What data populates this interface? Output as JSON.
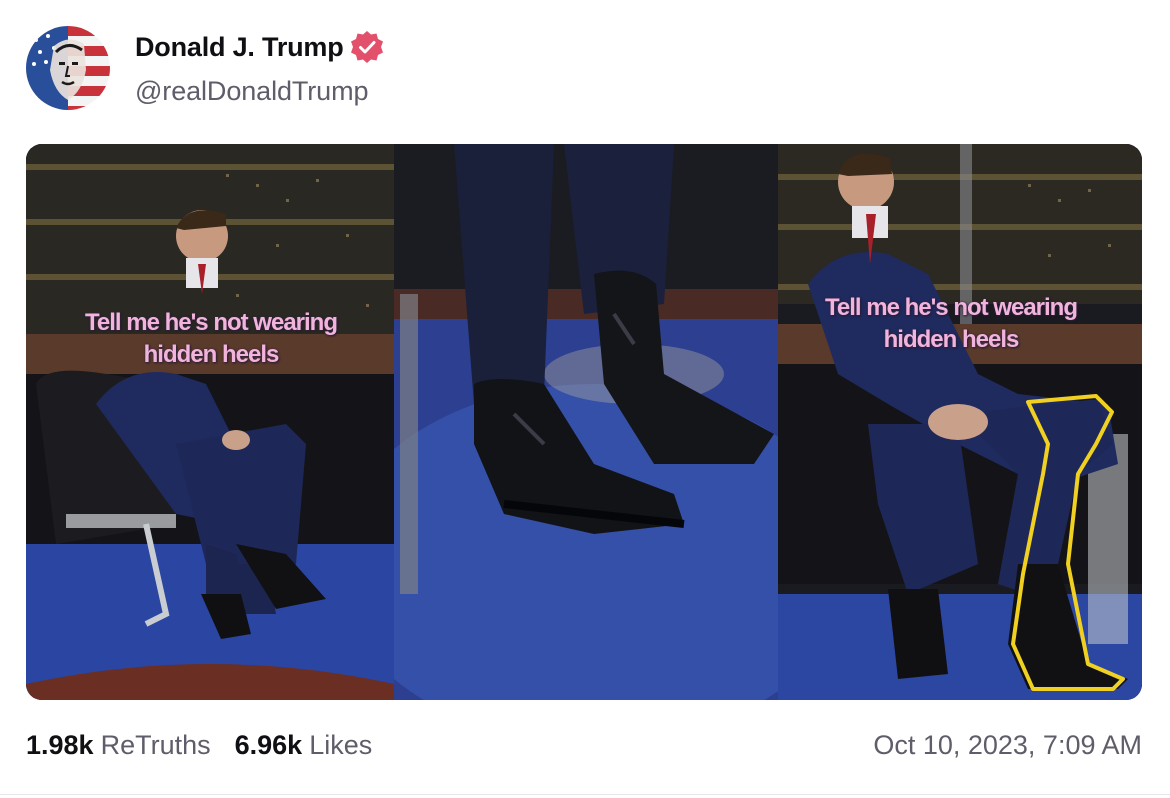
{
  "post": {
    "author_name": "Donald J. Trump",
    "handle": "@realDonaldTrump",
    "verified": true
  },
  "media": {
    "panels": [
      {
        "caption_line1": "Tell me he's not wearing",
        "caption_line2": "hidden heels"
      },
      {
        "caption_line1": "",
        "caption_line2": ""
      },
      {
        "caption_line1": "Tell me he's not wearing",
        "caption_line2": "hidden heels"
      }
    ]
  },
  "stats": {
    "retruths_count": "1.98k",
    "retruths_label": "ReTruths",
    "likes_count": "6.96k",
    "likes_label": "Likes"
  },
  "timestamp": "Oct 10, 2023, 7:09 AM",
  "colors": {
    "verified_badge": "#e3506b",
    "caption_text": "#f2b4dc",
    "secondary_text": "#5e5e6a",
    "highlight_outline": "#f0d020"
  },
  "icons": {
    "verified": "verified-badge-icon"
  }
}
